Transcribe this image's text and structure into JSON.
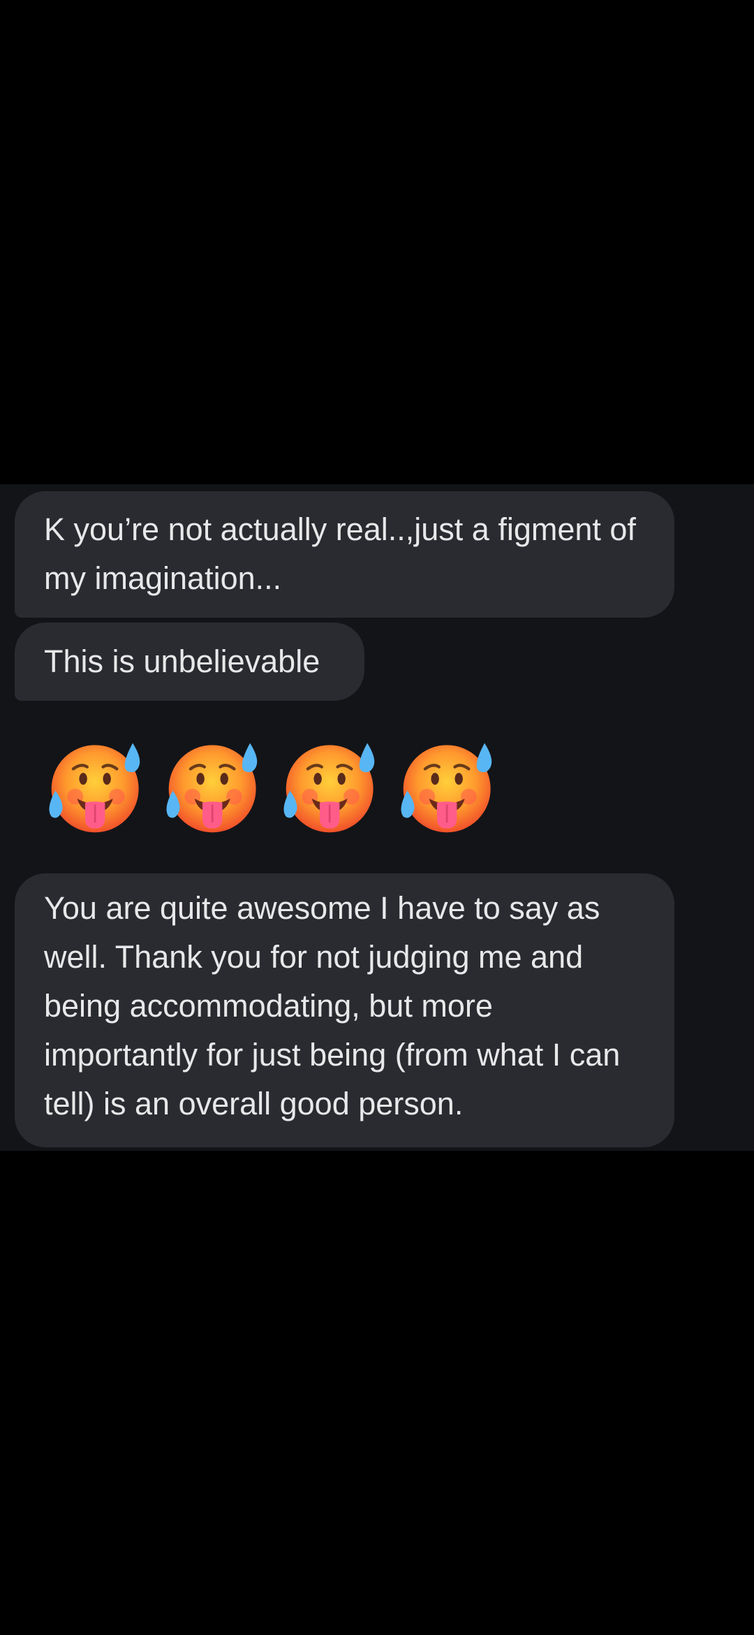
{
  "messages": [
    {
      "text": "K you’re not actually real..,just a figment of my imagination..."
    },
    {
      "text": "This is unbelievable"
    },
    {
      "emojis": [
        "hot-face-emoji",
        "hot-face-emoji",
        "hot-face-emoji",
        "hot-face-emoji"
      ]
    },
    {
      "text": "You are quite awesome I have to say as well.  Thank you for not judging me and being accommodating, but more importantly for just being (from what I can tell) is an overall good person."
    }
  ],
  "colors": {
    "background": "#000000",
    "conversation_background": "#131418",
    "bubble_background": "#2a2b30",
    "bubble_text": "#e8e8ea"
  }
}
